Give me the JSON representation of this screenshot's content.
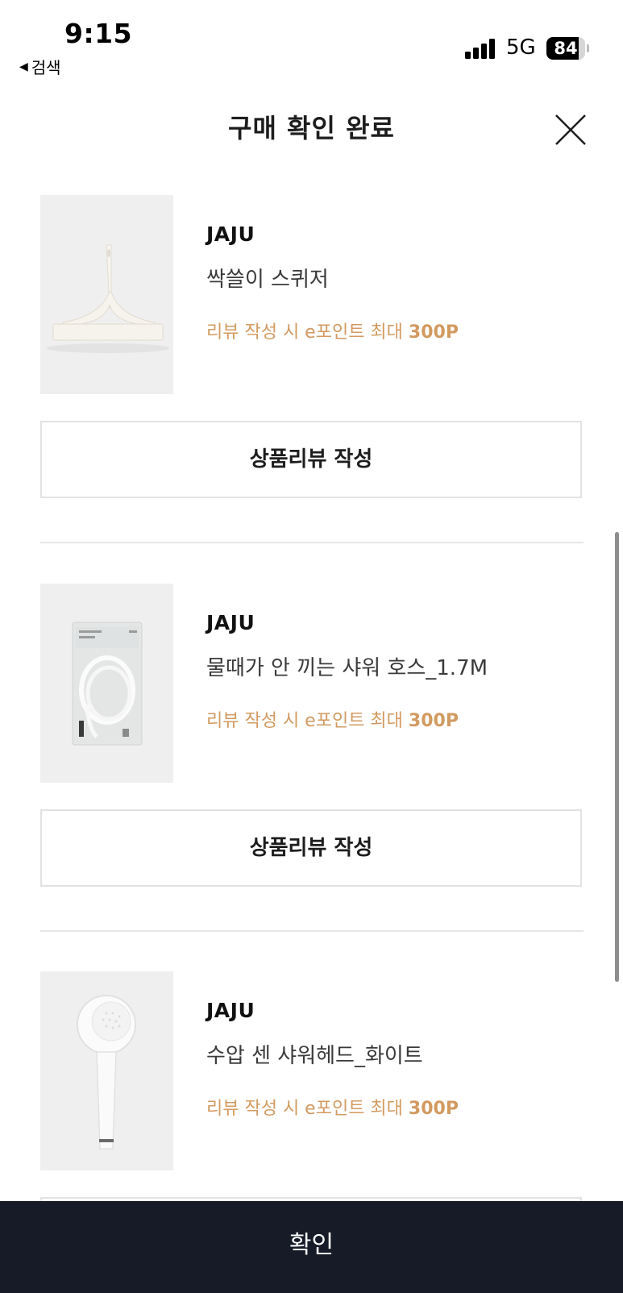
{
  "status_bar": {
    "time": "9:15",
    "back_label": "검색",
    "network": "5G",
    "battery": "84",
    "battery_level": 0.84
  },
  "header": {
    "title": "구매 확인 완료"
  },
  "products": [
    {
      "brand": "JAJU",
      "name": "싹쓸이 스퀴저",
      "reward_prefix": "리뷰 작성 시 e포인트 최대 ",
      "reward_points": "300P",
      "review_button": "상품리뷰 작성"
    },
    {
      "brand": "JAJU",
      "name": "물때가 안 끼는 샤워 호스_1.7M",
      "reward_prefix": "리뷰 작성 시 e포인트 최대 ",
      "reward_points": "300P",
      "review_button": "상품리뷰 작성"
    },
    {
      "brand": "JAJU",
      "name": "수압 센 샤워헤드_화이트",
      "reward_prefix": "리뷰 작성 시 e포인트 최대 ",
      "reward_points": "300P",
      "review_button": "상품리뷰 작성"
    }
  ],
  "footer": {
    "confirm_label": "확인"
  },
  "colors": {
    "accent_reward": "#d29a60",
    "footer_background": "#161b27"
  }
}
